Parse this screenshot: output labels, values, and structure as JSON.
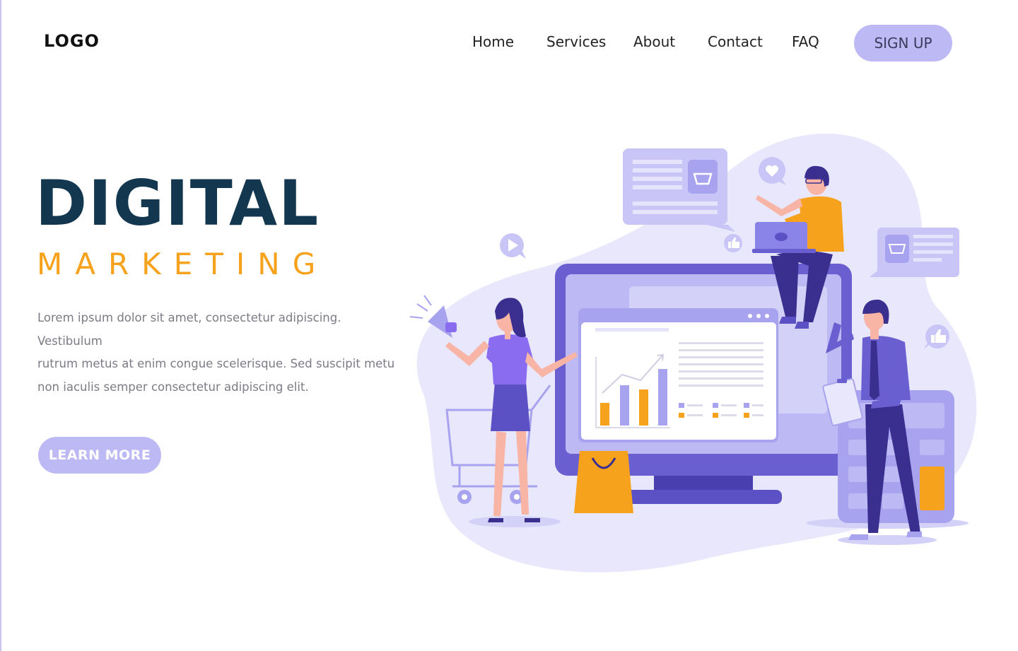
{
  "header": {
    "logo": "LOGO",
    "nav": [
      "Home",
      "Services",
      "About",
      "Contact",
      "FAQ"
    ],
    "signup_label": "SIGN UP"
  },
  "hero": {
    "title": "DIGITAL",
    "subtitle": "MARKETING",
    "description_lines": [
      "Lorem ipsum dolor sit amet, consectetur adipiscing. Vestibulum",
      "rutrum metus at enim congue scelerisque. Sed suscipit metu",
      "non iaculis semper consectetur adipiscing elit."
    ],
    "cta_label": "LEARN MORE"
  },
  "colors": {
    "accent": "#bdb9f4",
    "title": "#13374f",
    "subtitle": "#f6a21c",
    "body_text": "#7b7b86",
    "illustration_purple": "#5b50c4",
    "illustration_light": "#e9e7fc"
  },
  "icons": [
    "cart-icon",
    "heart-icon",
    "play-icon",
    "thumbs-up-icon",
    "megaphone-icon",
    "shopping-bag-icon",
    "calculator-icon",
    "laptop-icon",
    "clipboard-icon"
  ]
}
